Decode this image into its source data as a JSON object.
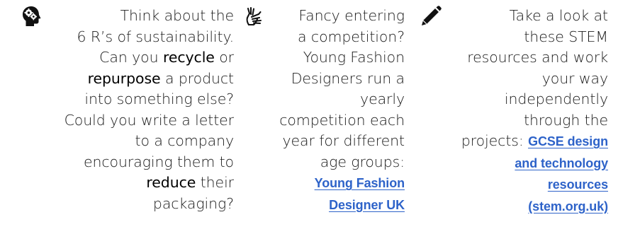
{
  "columns": [
    {
      "icon": "head-gear-icon",
      "lines": [
        [
          {
            "t": "Think about the"
          }
        ],
        [
          {
            "t": "6 R’s of sustainability."
          }
        ],
        [
          {
            "t": "Can you "
          },
          {
            "t": "recycle",
            "em": true
          },
          {
            "t": " or"
          }
        ],
        [
          {
            "t": "repurpose",
            "em": true
          },
          {
            "t": " a product"
          }
        ],
        [
          {
            "t": "into something else?"
          }
        ],
        [
          {
            "t": "Could you write a letter"
          }
        ],
        [
          {
            "t": "to a company"
          }
        ],
        [
          {
            "t": "encouraging them to"
          }
        ],
        [
          {
            "t": "reduce",
            "em": true
          },
          {
            "t": " their"
          }
        ],
        [
          {
            "t": "packaging?"
          }
        ]
      ]
    },
    {
      "icon": "sign-language-hands-icon",
      "lines": [
        [
          {
            "t": "Fancy entering"
          }
        ],
        [
          {
            "t": "a competition?"
          }
        ],
        [
          {
            "t": "Young Fashion"
          }
        ],
        [
          {
            "t": "Designers run a"
          }
        ],
        [
          {
            "t": "yearly"
          }
        ],
        [
          {
            "t": "competition each"
          }
        ],
        [
          {
            "t": "year for different"
          }
        ],
        [
          {
            "t": "age groups:"
          }
        ],
        [
          {
            "t": "Young Fashion",
            "link": true
          }
        ],
        [
          {
            "t": "Designer UK",
            "link": true
          }
        ]
      ]
    },
    {
      "icon": "pencil-icon",
      "lines": [
        [
          {
            "t": "Take a look at"
          }
        ],
        [
          {
            "t": "these STEM"
          }
        ],
        [
          {
            "t": "resources and work"
          }
        ],
        [
          {
            "t": "your way"
          }
        ],
        [
          {
            "t": "independently"
          }
        ],
        [
          {
            "t": "through the"
          }
        ],
        [
          {
            "t": "projects: "
          },
          {
            "t": "GCSE design",
            "link": true
          }
        ],
        [
          {
            "t": "and technology",
            "link": true
          }
        ],
        [
          {
            "t": "resources",
            "link": true
          }
        ],
        [
          {
            "t": "(stem.org.uk)",
            "link": true
          }
        ]
      ]
    }
  ],
  "colors": {
    "text": "#1a1a1a",
    "link": "#2e63c9"
  }
}
